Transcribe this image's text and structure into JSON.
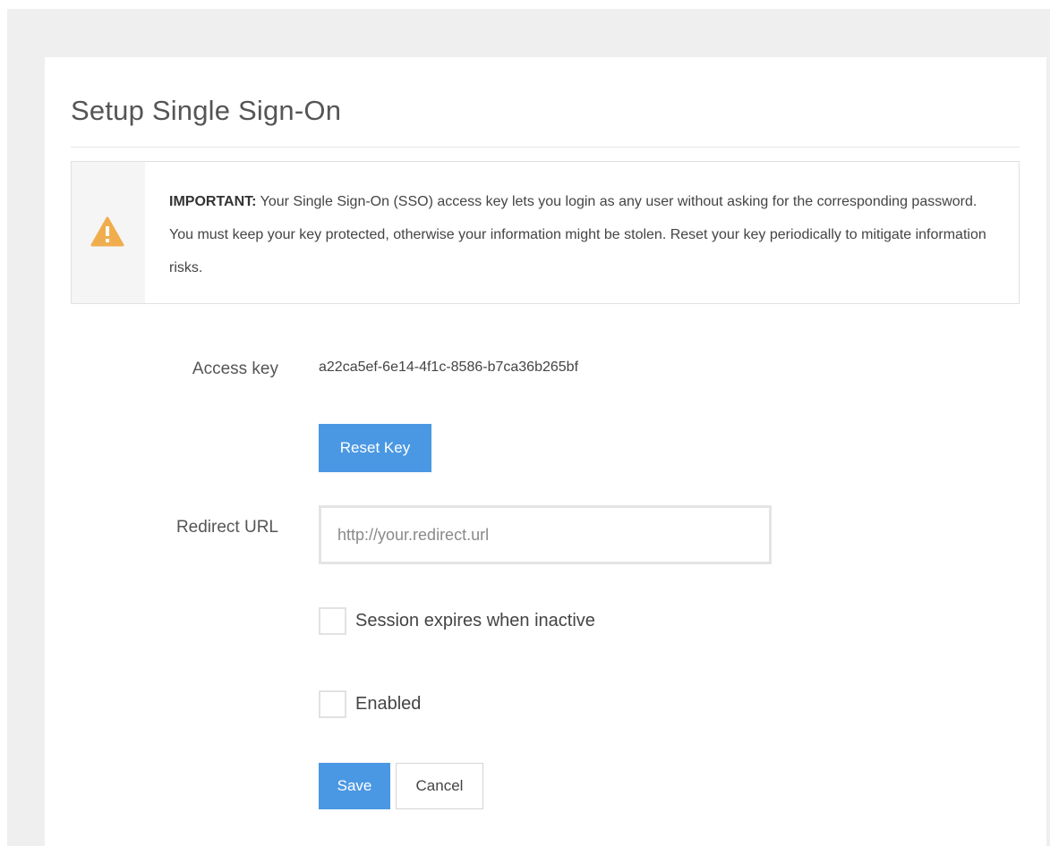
{
  "page": {
    "title": "Setup Single Sign-On"
  },
  "alert": {
    "icon": "warning-icon",
    "icon_color": "#f0ad4e",
    "strong": "IMPORTANT:",
    "message": "Your Single Sign-On (SSO) access key lets you login as any user without asking for the corresponding password. You must keep your key protected, otherwise your information might be stolen. Reset your key periodically to mitigate information risks."
  },
  "access_key": {
    "label": "Access key",
    "value": "a22ca5ef-6e14-4f1c-8586-b7ca36b265bf",
    "reset_label": "Reset Key"
  },
  "redirect": {
    "label": "Redirect URL",
    "value": "",
    "placeholder": "http://your.redirect.url"
  },
  "options": {
    "session_expires": {
      "label": "Session expires when inactive",
      "checked": false
    },
    "enabled": {
      "label": "Enabled",
      "checked": false
    }
  },
  "actions": {
    "save_label": "Save",
    "cancel_label": "Cancel"
  },
  "colors": {
    "primary": "#4a98e3",
    "background": "#efefef"
  }
}
